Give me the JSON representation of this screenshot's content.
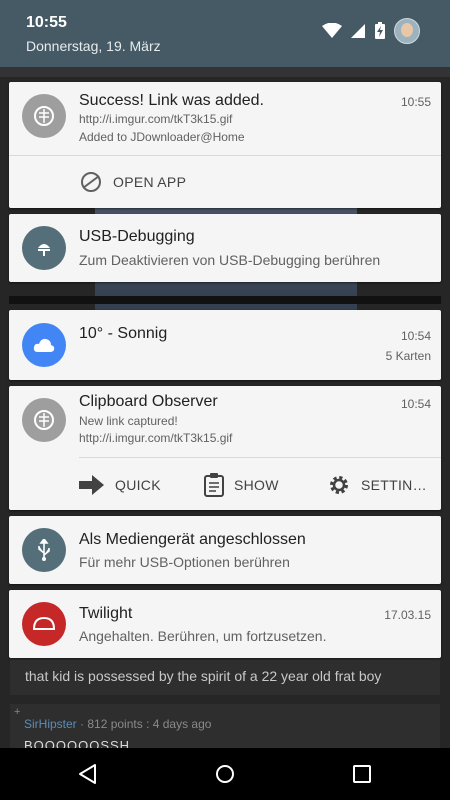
{
  "status_bar": {
    "time": "10:55",
    "date": "Donnerstag, 19. März"
  },
  "background_app": {
    "comment_text": "that kid is possessed by the spirit of a 22 year old frat boy",
    "comment_user": "SirHipster",
    "comment_meta": " · 812 points : 4 days ago",
    "comment_body": "BOOOOOOSSH"
  },
  "notifications": [
    {
      "id": "success",
      "title": "Success! Link was added.",
      "time": "10:55",
      "line1": "http://i.imgur.com/tkT3k15.gif",
      "line2": "Added to JDownloader@Home",
      "icon": "jdownloader-icon",
      "icon_color": "#9e9e9e",
      "action": "OPEN APP"
    },
    {
      "id": "usb-debugging",
      "title": "USB-Debugging",
      "line1": "Zum Deaktivieren von USB-Debugging berühren",
      "icon": "android-icon",
      "icon_color": "#546e7a"
    },
    {
      "id": "weather",
      "title": "10° - Sonnig",
      "time": "10:54",
      "count": "5 Karten",
      "icon": "cloud-icon",
      "icon_color": "#4285f4"
    },
    {
      "id": "clipboard",
      "title": "Clipboard Observer",
      "time": "10:54",
      "line1": "New link captured!",
      "line2": "http://i.imgur.com/tkT3k15.gif",
      "icon": "jdownloader-icon",
      "icon_color": "#9e9e9e",
      "actions": [
        "QUICK",
        "SHOW",
        "SETTIN…"
      ]
    },
    {
      "id": "media-device",
      "title": "Als Mediengerät angeschlossen",
      "line1": "Für mehr USB-Optionen berühren",
      "icon": "usb-icon",
      "icon_color": "#546e7a"
    },
    {
      "id": "twilight",
      "title": "Twilight",
      "time": "17.03.15",
      "line1": "Angehalten. Berühren, um fortzusetzen.",
      "icon": "twilight-icon",
      "icon_color": "#c62828"
    }
  ],
  "navigation": {
    "back": "back-icon",
    "home": "home-icon",
    "recents": "recents-icon"
  }
}
